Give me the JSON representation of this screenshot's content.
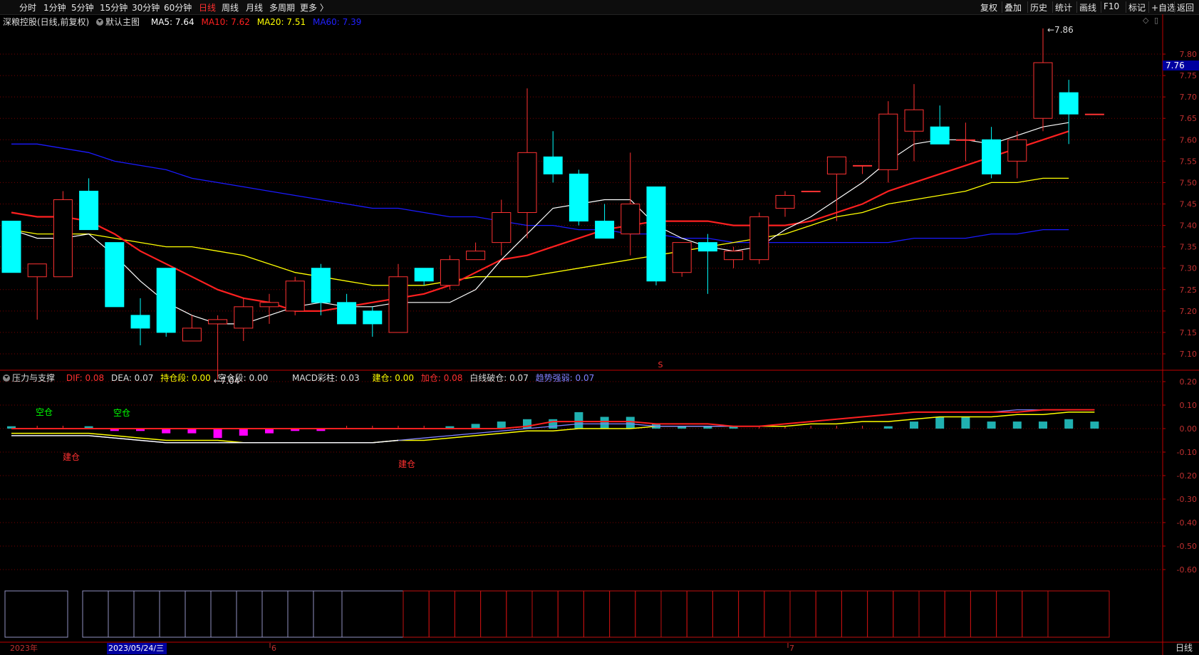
{
  "toolbar": {
    "periods": [
      "分时",
      "1分钟",
      "5分钟",
      "15分钟",
      "30分钟",
      "60分钟",
      "日线",
      "周线",
      "月线",
      "多周期",
      "更多 〉"
    ],
    "active_period": "日线",
    "right_buttons": [
      "复权",
      "叠加",
      "历史",
      "统计",
      "画线",
      "F10",
      "标记",
      "+自选",
      "返回"
    ]
  },
  "main_legend": {
    "title": "深粮控股(日线,前复权)",
    "template": "默认主图",
    "ma5": "MA5: 7.64",
    "ma10": "MA10: 7.62",
    "ma20": "MA20: 7.51",
    "ma60": "MA60: 7.39"
  },
  "sub_legend": {
    "name": "压力与支撑",
    "dif": "DIF: 0.08",
    "dea": "DEA: 0.07",
    "hold": "持仓段: 0.00",
    "empty": "空仓段: 0.00",
    "macd": "MACD彩柱: 0.03",
    "jiancang": "建仓: 0.00",
    "jiacang": "加仓: 0.08",
    "baixian": "白线破仓: 0.07",
    "qushi": "趋势强弱: 0.07"
  },
  "price_axis": {
    "labels": [
      "7.80",
      "7.75",
      "7.70",
      "7.65",
      "7.60",
      "7.55",
      "7.50",
      "7.45",
      "7.40",
      "7.35",
      "7.30",
      "7.25",
      "7.20",
      "7.15",
      "7.10"
    ],
    "current": "7.76",
    "high_label": "7.86",
    "low_label": "7.04"
  },
  "sub_axis": {
    "labels": [
      "0.20",
      "0.10",
      "0.00",
      "-0.10",
      "-0.20",
      "-0.30",
      "-0.40",
      "-0.50",
      "-0.60"
    ]
  },
  "annotations": {
    "kong1": "空仓",
    "kong2": "空仓",
    "jian1": "建仓",
    "jian2": "建仓",
    "s_marker": "S"
  },
  "date_axis": {
    "year": "2023年",
    "cursor": "2023/05/24/三",
    "m6": "6",
    "m7": "7",
    "period": "日线"
  },
  "colors": {
    "up": "#ff3232",
    "down": "#00ffff",
    "ma5": "#ffffff",
    "ma10": "#ff2020",
    "ma20": "#ffff00",
    "ma60": "#1a1aff"
  },
  "chart_data": {
    "type": "candlestick",
    "ohlc": [
      [
        7.41,
        7.41,
        7.29,
        7.29
      ],
      [
        7.28,
        7.31,
        7.18,
        7.31
      ],
      [
        7.28,
        7.48,
        7.28,
        7.46
      ],
      [
        7.48,
        7.51,
        7.39,
        7.39
      ],
      [
        7.36,
        7.36,
        7.21,
        7.21
      ],
      [
        7.19,
        7.23,
        7.12,
        7.16
      ],
      [
        7.3,
        7.3,
        7.14,
        7.15
      ],
      [
        7.13,
        7.19,
        7.13,
        7.16
      ],
      [
        7.17,
        7.19,
        7.04,
        7.18
      ],
      [
        7.16,
        7.23,
        7.13,
        7.21
      ],
      [
        7.21,
        7.24,
        7.17,
        7.22
      ],
      [
        7.2,
        7.28,
        7.19,
        7.27
      ],
      [
        7.3,
        7.31,
        7.19,
        7.22
      ],
      [
        7.22,
        7.24,
        7.17,
        7.17
      ],
      [
        7.2,
        7.21,
        7.14,
        7.17
      ],
      [
        7.15,
        7.31,
        7.15,
        7.28
      ],
      [
        7.3,
        7.3,
        7.26,
        7.27
      ],
      [
        7.26,
        7.33,
        7.25,
        7.32
      ],
      [
        7.32,
        7.36,
        7.32,
        7.34
      ],
      [
        7.36,
        7.46,
        7.33,
        7.43
      ],
      [
        7.43,
        7.72,
        7.37,
        7.57
      ],
      [
        7.56,
        7.62,
        7.5,
        7.52
      ],
      [
        7.52,
        7.53,
        7.4,
        7.41
      ],
      [
        7.41,
        7.45,
        7.37,
        7.37
      ],
      [
        7.38,
        7.57,
        7.33,
        7.45
      ],
      [
        7.49,
        7.49,
        7.26,
        7.27
      ],
      [
        7.29,
        7.36,
        7.28,
        7.36
      ],
      [
        7.36,
        7.38,
        7.24,
        7.34
      ],
      [
        7.32,
        7.35,
        7.3,
        7.34
      ],
      [
        7.32,
        7.43,
        7.31,
        7.42
      ],
      [
        7.44,
        7.48,
        7.42,
        7.47
      ],
      [
        7.48,
        7.48,
        7.48,
        7.48
      ],
      [
        7.52,
        7.56,
        7.41,
        7.56
      ],
      [
        7.54,
        7.54,
        7.52,
        7.54
      ],
      [
        7.53,
        7.69,
        7.5,
        7.66
      ],
      [
        7.62,
        7.73,
        7.55,
        7.67
      ],
      [
        7.63,
        7.68,
        7.59,
        7.59
      ],
      [
        7.6,
        7.64,
        7.55,
        7.6
      ],
      [
        7.6,
        7.63,
        7.51,
        7.52
      ],
      [
        7.55,
        7.62,
        7.51,
        7.6
      ],
      [
        7.65,
        7.86,
        7.62,
        7.78
      ],
      [
        7.71,
        7.74,
        7.59,
        7.66
      ],
      [
        7.66,
        7.66,
        7.66,
        7.66
      ]
    ],
    "ma5": [
      7.39,
      7.37,
      7.37,
      7.38,
      7.33,
      7.27,
      7.22,
      7.19,
      7.17,
      7.17,
      7.19,
      7.21,
      7.22,
      7.21,
      7.21,
      7.22,
      7.22,
      7.22,
      7.25,
      7.32,
      7.38,
      7.44,
      7.45,
      7.46,
      7.46,
      7.4,
      7.37,
      7.35,
      7.34,
      7.35,
      7.39,
      7.42,
      7.46,
      7.5,
      7.55,
      7.59,
      7.6,
      7.6,
      7.59,
      7.61,
      7.63,
      7.64
    ],
    "ma10": [
      7.43,
      7.42,
      7.42,
      7.41,
      7.38,
      7.34,
      7.31,
      7.28,
      7.25,
      7.23,
      7.22,
      7.2,
      7.2,
      7.21,
      7.22,
      7.23,
      7.24,
      7.26,
      7.29,
      7.32,
      7.33,
      7.35,
      7.37,
      7.39,
      7.4,
      7.41,
      7.41,
      7.41,
      7.4,
      7.4,
      7.4,
      7.41,
      7.43,
      7.45,
      7.48,
      7.5,
      7.52,
      7.54,
      7.56,
      7.58,
      7.6,
      7.62
    ],
    "ma20": [
      7.39,
      7.38,
      7.38,
      7.38,
      7.37,
      7.36,
      7.35,
      7.35,
      7.34,
      7.33,
      7.31,
      7.29,
      7.28,
      7.27,
      7.26,
      7.26,
      7.26,
      7.27,
      7.28,
      7.28,
      7.28,
      7.29,
      7.3,
      7.31,
      7.32,
      7.33,
      7.34,
      7.35,
      7.36,
      7.37,
      7.38,
      7.4,
      7.42,
      7.43,
      7.45,
      7.46,
      7.47,
      7.48,
      7.5,
      7.5,
      7.51,
      7.51
    ],
    "ma60": [
      7.59,
      7.59,
      7.58,
      7.57,
      7.55,
      7.54,
      7.53,
      7.51,
      7.5,
      7.49,
      7.48,
      7.47,
      7.46,
      7.45,
      7.44,
      7.44,
      7.43,
      7.42,
      7.42,
      7.41,
      7.4,
      7.4,
      7.39,
      7.39,
      7.38,
      7.38,
      7.37,
      7.37,
      7.36,
      7.36,
      7.36,
      7.36,
      7.36,
      7.36,
      7.36,
      7.37,
      7.37,
      7.37,
      7.38,
      7.38,
      7.39,
      7.39
    ],
    "macd_bars": [
      0.01,
      0,
      0,
      0.01,
      -0.01,
      -0.01,
      -0.02,
      -0.02,
      -0.04,
      -0.03,
      -0.02,
      -0.01,
      -0.01,
      0,
      0,
      0,
      0,
      0.01,
      0.02,
      0.03,
      0.04,
      0.04,
      0.07,
      0.05,
      0.05,
      0.02,
      0.01,
      0.01,
      0.01,
      0,
      0,
      0,
      0,
      0,
      0.01,
      0.03,
      0.05,
      0.05,
      0.03,
      0.03,
      0.03,
      0.04,
      0.03
    ],
    "dif": [
      -0.03,
      -0.03,
      -0.03,
      -0.03,
      -0.04,
      -0.05,
      -0.06,
      -0.06,
      -0.06,
      -0.06,
      -0.06,
      -0.06,
      -0.06,
      -0.06,
      -0.06,
      -0.05,
      -0.04,
      -0.03,
      -0.02,
      -0.01,
      0.0,
      0.01,
      0.02,
      0.02,
      0.02,
      0.01,
      0.01,
      0.01,
      0.01,
      0.01,
      0.02,
      0.03,
      0.04,
      0.05,
      0.06,
      0.07,
      0.07,
      0.07,
      0.07,
      0.08,
      0.08,
      0.08,
      0.08
    ],
    "dea": [
      -0.02,
      -0.02,
      -0.02,
      -0.02,
      -0.03,
      -0.04,
      -0.05,
      -0.05,
      -0.05,
      -0.06,
      -0.06,
      -0.06,
      -0.06,
      -0.06,
      -0.06,
      -0.05,
      -0.05,
      -0.04,
      -0.03,
      -0.02,
      -0.01,
      -0.01,
      0.0,
      0.0,
      0.0,
      0.01,
      0.01,
      0.01,
      0.01,
      0.01,
      0.01,
      0.02,
      0.02,
      0.03,
      0.03,
      0.04,
      0.05,
      0.05,
      0.05,
      0.06,
      0.06,
      0.07,
      0.07
    ],
    "jiacang": [
      0,
      0,
      0,
      0,
      0,
      0,
      0,
      0,
      0,
      0,
      0,
      0,
      0,
      0,
      0,
      0,
      0,
      0,
      0,
      0,
      0.01,
      0.03,
      0.03,
      0.03,
      0.03,
      0.02,
      0.02,
      0.02,
      0.01,
      0.01,
      0.02,
      0.03,
      0.04,
      0.05,
      0.06,
      0.07,
      0.07,
      0.07,
      0.07,
      0.07,
      0.08,
      0.08,
      0.08
    ]
  }
}
